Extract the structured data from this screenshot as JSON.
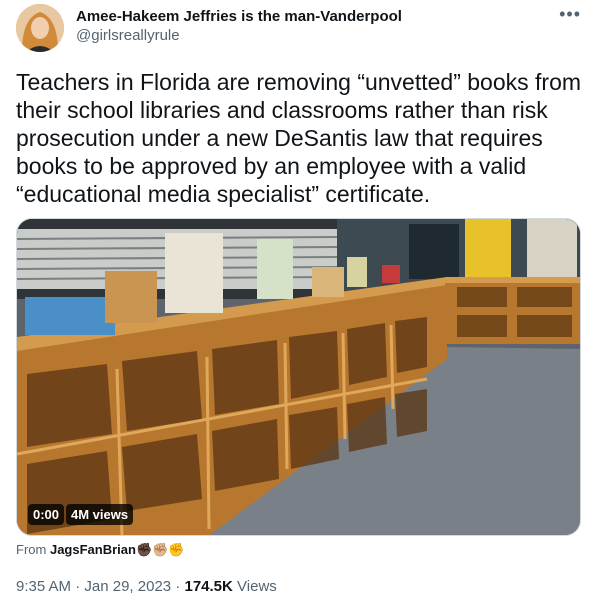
{
  "author": {
    "display_name": "Amee-Hakeem Jeffries is the man-Vanderpool",
    "handle": "@girlsreallyrule"
  },
  "more_icon": "more-options-icon",
  "tweet": {
    "text": "Teachers in Florida are removing “unvetted” books from their school libraries and classrooms rather than risk prosecution under a new DeSantis law that requires books to be approved by an employee with a valid “educational media specialist” certificate."
  },
  "video": {
    "time": "0:00",
    "views": "4M views"
  },
  "attribution": {
    "from_label": "From",
    "source": "JagsFanBrian",
    "emojis": "✊🏿✊🏼✊"
  },
  "meta": {
    "time": "9:35 AM",
    "date": "Jan 29, 2023",
    "view_count": "174.5K",
    "views_label": "Views"
  }
}
